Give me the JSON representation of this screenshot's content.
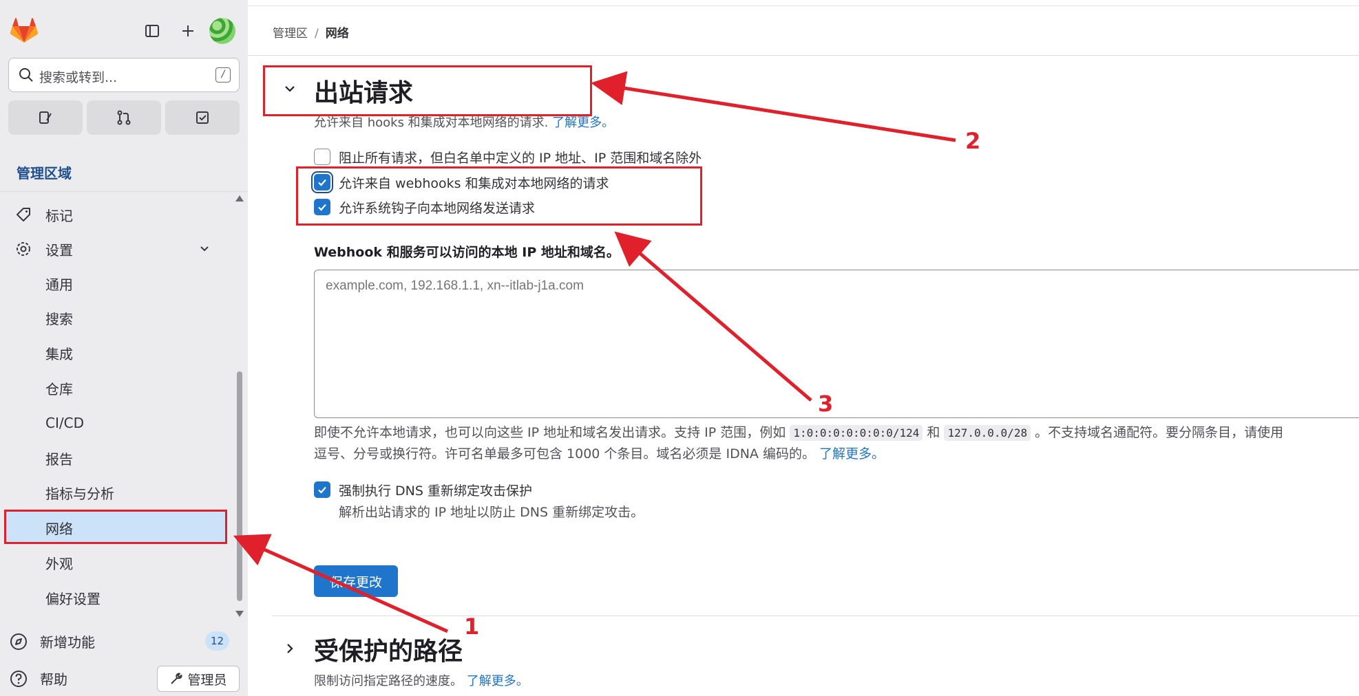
{
  "sidebar": {
    "search_placeholder": "搜索或转到...",
    "search_shortcut": "/",
    "area_title": "管理区域",
    "items": [
      {
        "label": "标记",
        "icon": "label-icon"
      },
      {
        "label": "设置",
        "icon": "settings-icon"
      },
      {
        "label": "通用"
      },
      {
        "label": "搜索"
      },
      {
        "label": "集成"
      },
      {
        "label": "仓库"
      },
      {
        "label": "CI/CD"
      },
      {
        "label": "报告"
      },
      {
        "label": "指标与分析"
      },
      {
        "label": "网络"
      },
      {
        "label": "外观"
      },
      {
        "label": "偏好设置"
      }
    ],
    "whats_new": "新增功能",
    "whats_new_count": "12",
    "help": "帮助",
    "admin_button": "管理员"
  },
  "breadcrumb": {
    "root": "管理区",
    "separator": "/",
    "current": "网络"
  },
  "outbound": {
    "title": "出站请求",
    "description": "允许来自 hooks 和集成对本地网络的请求.",
    "learn_more": "了解更多。",
    "options": [
      {
        "label": "阻止所有请求，但白名单中定义的 IP 地址、IP 范围和域名除外",
        "checked": false
      },
      {
        "label": "允许来自 webhooks 和集成对本地网络的请求",
        "checked": true
      },
      {
        "label": "允许系统钩子向本地网络发送请求",
        "checked": true
      }
    ],
    "allowlist_label": "Webhook 和服务可以访问的本地 IP 地址和域名。",
    "allowlist_placeholder": "example.com, 192.168.1.1, xn--itlab-j1a.com",
    "help_part1": "即使不允许本地请求，也可以向这些 IP 地址和域名发出请求。支持 IP 范围，例如",
    "help_code1": "1:0:0:0:0:0:0:0/124",
    "help_and": "和",
    "help_code2": "127.0.0.0/28",
    "help_part2": "。不支持域名通配符。要分隔条目，请使用",
    "help_part3": "逗号、分号或换行符。许可名单最多可包含 1000 个条目。域名必须是 IDNA 编码的。",
    "help_learn_more": "了解更多。",
    "dns_label": "强制执行 DNS 重新绑定攻击保护",
    "dns_checked": true,
    "dns_help": "解析出站请求的 IP 地址以防止 DNS 重新绑定攻击。",
    "save_label": "保存更改"
  },
  "protected_paths": {
    "title": "受保护的路径",
    "description": "限制访问指定路径的速度。",
    "learn_more": "了解更多。"
  },
  "annotations": {
    "labels": [
      "1",
      "2",
      "3"
    ],
    "color": "#e0202a"
  },
  "colors": {
    "accent": "#1f75cb",
    "sidebar_bg": "#ececef",
    "active_bg": "#cbe2f9"
  }
}
